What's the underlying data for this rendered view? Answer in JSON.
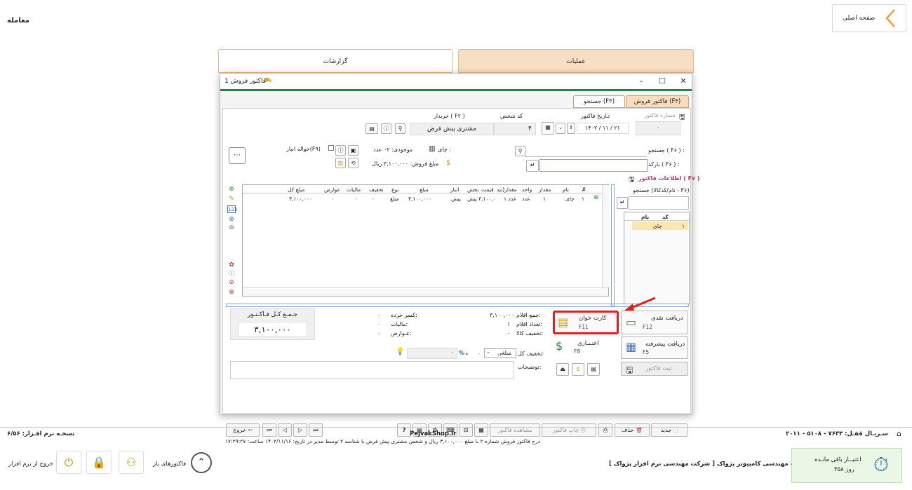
{
  "page": {
    "title": "معامله",
    "home_label": "صفحه اصلی"
  },
  "top_tabs": {
    "reports": "گزارشات",
    "operations": "عملیات"
  },
  "window": {
    "title": "فاکتور فروش 1",
    "tab_sales": "فاکتور فروش (F۴)",
    "tab_search": "جستجو (F۳)"
  },
  "invoice": {
    "number_label": "شماره فاکتور",
    "number": "۰",
    "date_label": "تـاریخ فاکتور",
    "date": "۱۴۰۲ / ۱۱ / ۲۱",
    "person_code_label": "کد شخص",
    "person_code": "۴",
    "buyer_label": "خریدار ( F۲ )",
    "buyer": "مشتری پیش فرض"
  },
  "search": {
    "label": "جستجو ( F۶ ) :",
    "barcode_label": "بارکد ( F۶ ) :"
  },
  "info": {
    "label": "اطلاعات فاکتور ( F۷ )",
    "name_search": "جستجو (نام/کدکالا - F۶)"
  },
  "product": {
    "name_line": "چای : ",
    "stock": "موجودی: ۰۲ عدد",
    "sale_amount": "مبلغ فروش: ۳,۱۰۰,۰۰۰ ریال",
    "transfer": "حواله انبار(F۹)"
  },
  "grid": {
    "headers": [
      "#",
      "نام",
      "مقدار",
      "واحد",
      "مقدار(تبد",
      "قیمت",
      "بخش",
      "انبار",
      "مبلغ",
      "نوع",
      "تخفیف",
      "مالیات",
      "عوارض",
      "مبلغ کل"
    ],
    "row": [
      "۱",
      "چای",
      "۱",
      "عدد",
      "۱ عدد",
      "۳,۱۰۰,۰",
      "پیش",
      "پیش",
      "۳,۱۰۰,۰۰۰",
      "مبلغ",
      "۰",
      "۰",
      "۰",
      "۳,۱۰۰,۰۰۰"
    ]
  },
  "lookup": {
    "col_code": "کد",
    "col_name": "نام",
    "row_code": "۱",
    "row_name": "چای"
  },
  "totals": {
    "grand_label": "جـمـع کـل فـاکـتـور",
    "grand_value": "۳,۱۰۰,۰۰۰",
    "items_sum_label": "جمع اقلام:",
    "items_sum": "۳,۱۰۰,۰۰۰",
    "items_count_label": "تعداد اقلام:",
    "items_count": "۱",
    "goods_discount_label": "تخفیف کالا:",
    "goods_discount": "۰",
    "change_label": "کسر خرده:",
    "change": "۰",
    "tax_label": "مالیات:",
    "tax": "۰",
    "duties_label": "عـوارض:",
    "duties": "۰",
    "discount_label": "تخفیف کل:",
    "discount_type": "مبلغی",
    "discount_value": "۰",
    "notes_label": "توضیحات:"
  },
  "payments": {
    "cash": "دریافت نقدی",
    "cash_key": "F12",
    "card": "کارت خوان",
    "card_key": "F11",
    "advanced": "دریافت پیشرفته",
    "advanced_key": "F5",
    "credit": "اعتـبـاری",
    "credit_key": "F8",
    "register": "ثبت فاکتور"
  },
  "toolbar": {
    "new": "جدید",
    "delete": "حذف",
    "print": "چاپ فاکتور",
    "view": "مشاهده فاکتور",
    "exit": "خروج"
  },
  "status": "درج فاکتور فروش شماره ۲ با مبلغ ۳,۱۰۰,۰۰۰ ریال و شخص مشتری پیش فرض با شناسه ۲ توسط مدیر در تاریخ: ۱۴۰۲/۱۱/۱۶ ساعت: ۱۷:۲۹:۲۷",
  "footer": {
    "version": "نسخـه نرم افـزار: ۶/۵۶",
    "site": "PejvakShop.ir",
    "serial": "سـریـال قفـل: ۷۶۳۴ - ۵۱۰۸ - ۲۰۱۱",
    "company": "شرکت مهندسی کامپیوتر پژواک [ شرکت مهندسی نرم افزار پژواک ]",
    "open_invoices": "فاکتورهای باز",
    "exit_app": "خروج از نرم افزار",
    "license_label": "اعتبــار باقی مانـده",
    "license_days": "۳۵۸ روز"
  }
}
